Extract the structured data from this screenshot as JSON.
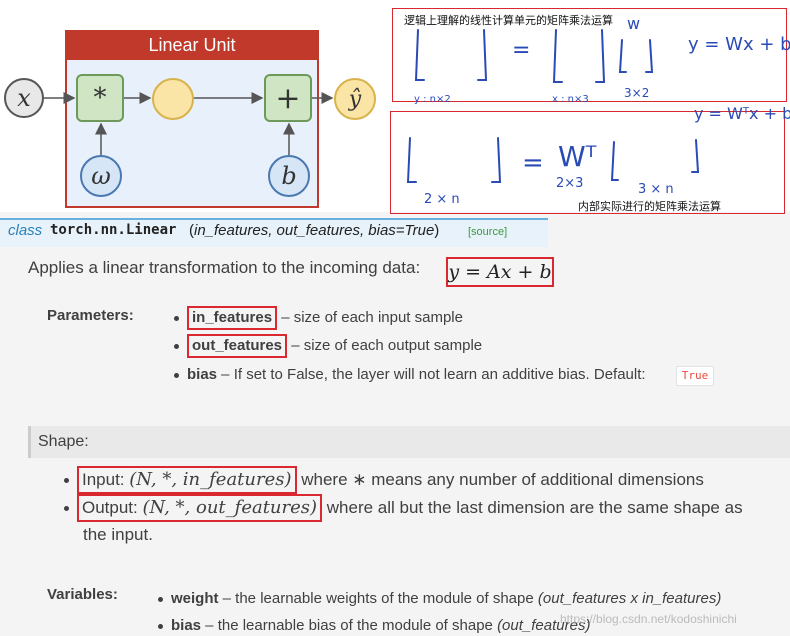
{
  "diagram": {
    "title": "Linear Unit",
    "nodes": {
      "x": "x",
      "multiply": "*",
      "plus": "+",
      "yhat": "ŷ",
      "weight": "ω",
      "bias": "b"
    }
  },
  "notes": {
    "label_top": "逻辑上理解的线性计算单元的矩阵乘法运算",
    "label_bottom": "内部实际进行的矩阵乘法运算",
    "hw": {
      "eq_equals": "=",
      "w_label": "w",
      "formula1": "y = Wx + b",
      "formula2": "y = Wᵀx + b",
      "dim_y": "y : n×2",
      "dim_x": "x : n×3",
      "dim_w": "3×2",
      "wt": "Wᵀ",
      "dim_2n": "2 × n",
      "dim_2x3": "2×3",
      "dim_3n": "3 × n"
    }
  },
  "doc": {
    "class_keyword": "class",
    "class_name": "torch.nn.Linear",
    "class_args": "in_features, out_features, bias=True",
    "source_link": "[source]",
    "description": "Applies a linear transformation to the incoming data:",
    "formula": "y = Ax + b",
    "parameters_label": "Parameters:",
    "params": [
      {
        "name": "in_features",
        "desc": " – size of each input sample"
      },
      {
        "name": "out_features",
        "desc": " – size of each output sample"
      },
      {
        "name": "bias",
        "desc": " – If set to False, the layer will not learn an additive bias. Default: "
      }
    ],
    "bias_default": "True",
    "shape_label": "Shape:",
    "shape": {
      "input_label": "Input: ",
      "input_math": "(N, *, in_features)",
      "input_rest": " where ∗ means any number of additional dimensions",
      "output_label": "Output: ",
      "output_math": "(N, *, out_features)",
      "output_rest": " where all but the last dimension are the same shape as",
      "output_rest2": "the input."
    },
    "variables_label": "Variables:",
    "variables": [
      {
        "name": "weight",
        "desc": " – the learnable weights of the module of shape ",
        "shape": "(out_features x in_features)"
      },
      {
        "name": "bias",
        "desc": " – the learnable bias of the module of shape ",
        "shape": "(out_features)"
      }
    ]
  },
  "watermark": "https://blog.csdn.net/kodoshinichi"
}
